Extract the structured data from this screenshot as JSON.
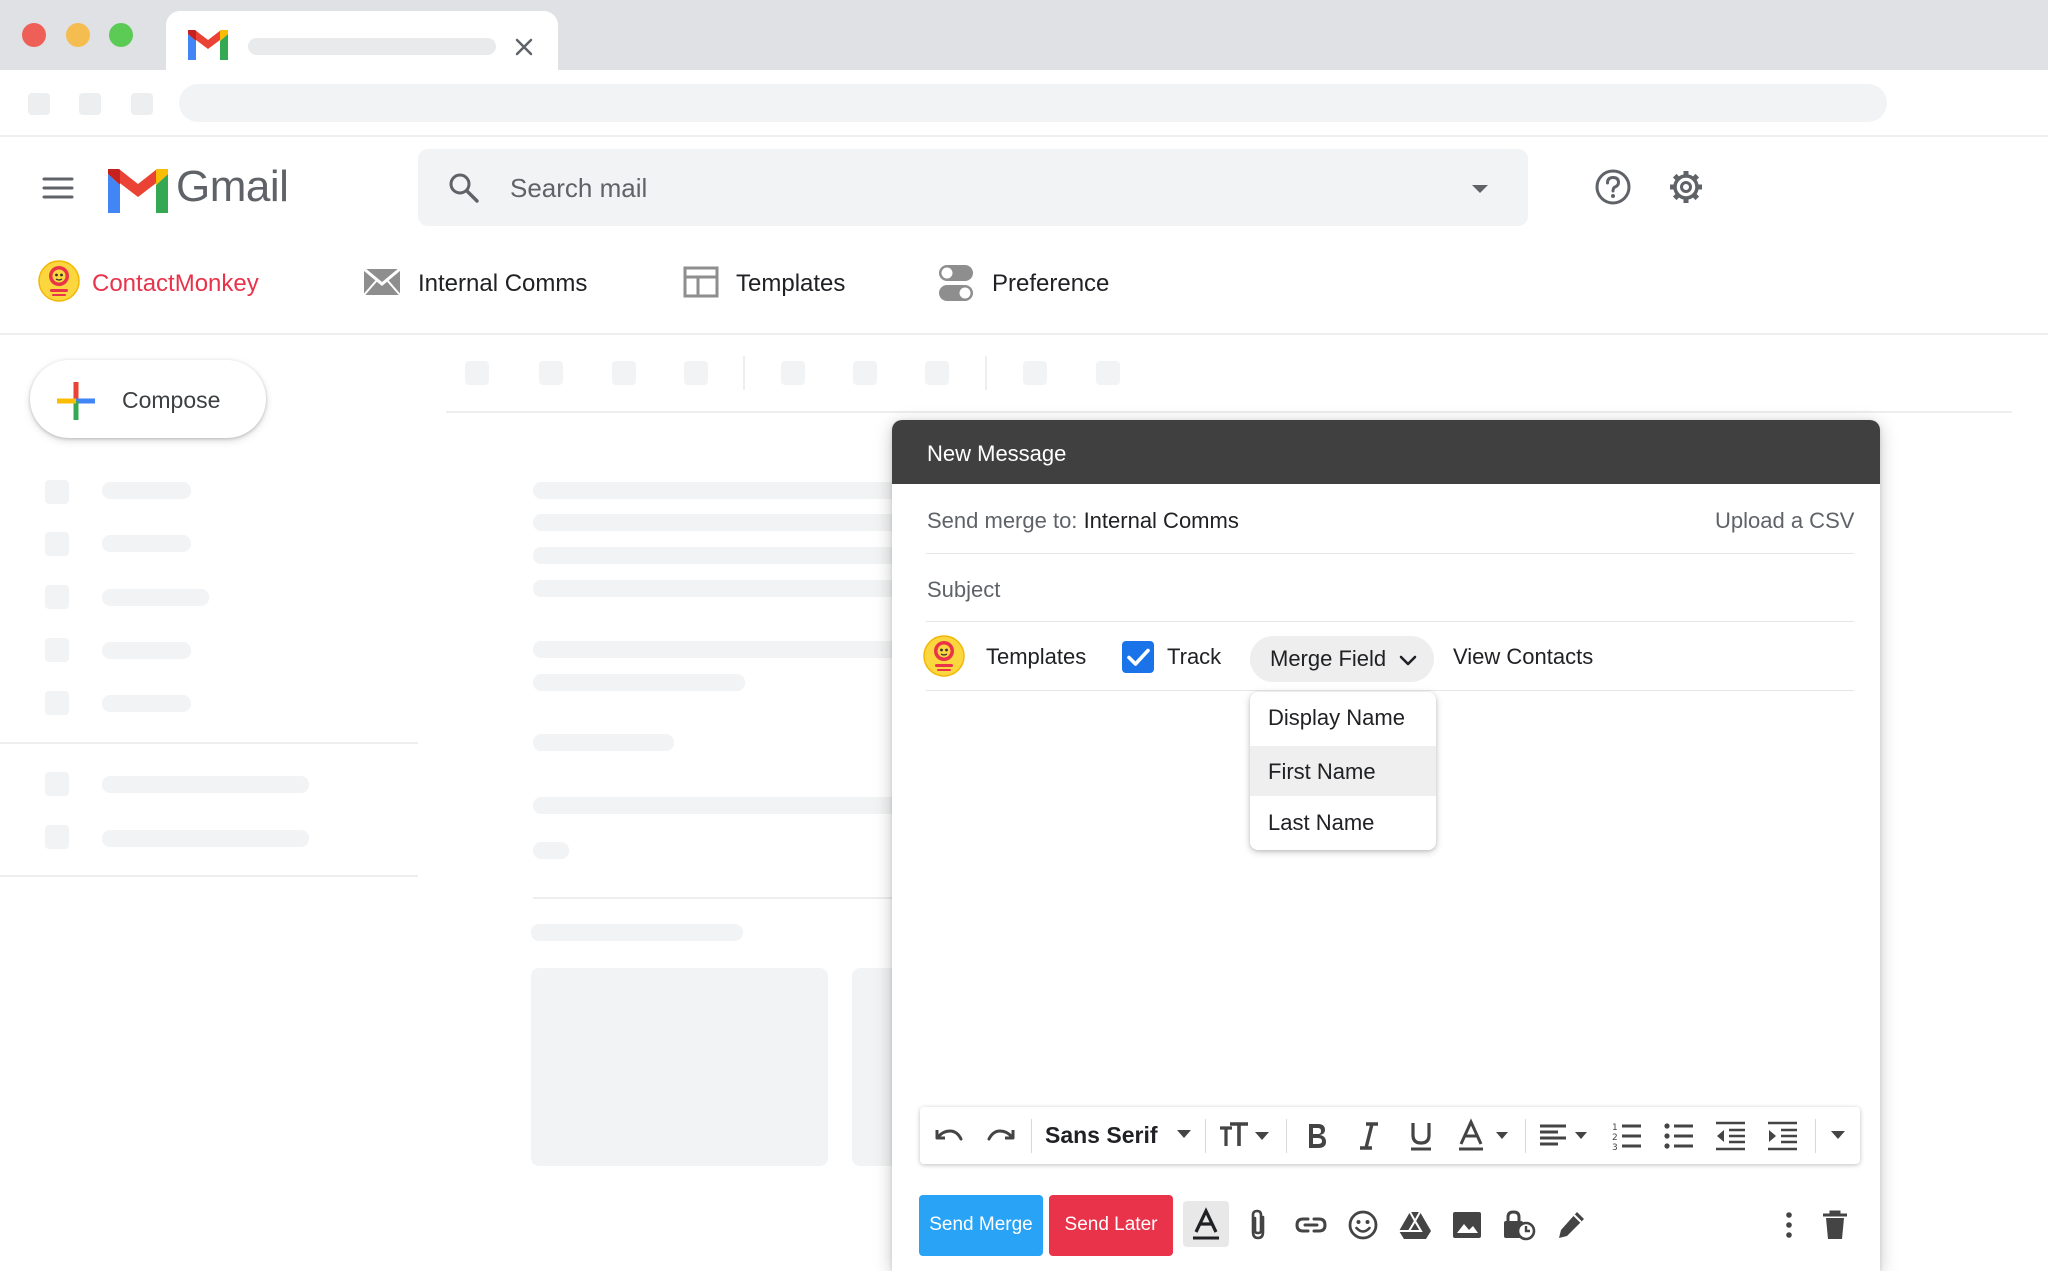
{
  "header": {
    "app_name": "Gmail",
    "search_placeholder": "Search mail"
  },
  "extension_bar": {
    "brand": "ContactMonkey",
    "items": [
      {
        "label": "Internal Comms",
        "icon": "envelope-icon"
      },
      {
        "label": "Templates",
        "icon": "layout-icon"
      },
      {
        "label": "Preference",
        "icon": "toggle-icon"
      }
    ]
  },
  "sidebar": {
    "compose_label": "Compose"
  },
  "compose": {
    "title": "New Message",
    "send_merge_prefix": "Send merge to:",
    "send_merge_target": "Internal Comms",
    "upload_csv": "Upload a CSV",
    "subject_placeholder": "Subject",
    "toolbar": {
      "templates": "Templates",
      "track": "Track",
      "track_checked": true,
      "merge_field": "Merge Field",
      "view_contacts": "View Contacts"
    },
    "merge_field_options": [
      "Display Name",
      "First Name",
      "Last Name"
    ],
    "highlighted_option": "First Name",
    "font_name": "Sans Serif",
    "send_merge_button": "Send Merge",
    "send_later_button": "Send Later"
  },
  "colors": {
    "accent_blue": "#1a73e8",
    "send_merge_blue": "#29a3f5",
    "brand_red": "#e8334a",
    "compose_header": "#404040"
  }
}
